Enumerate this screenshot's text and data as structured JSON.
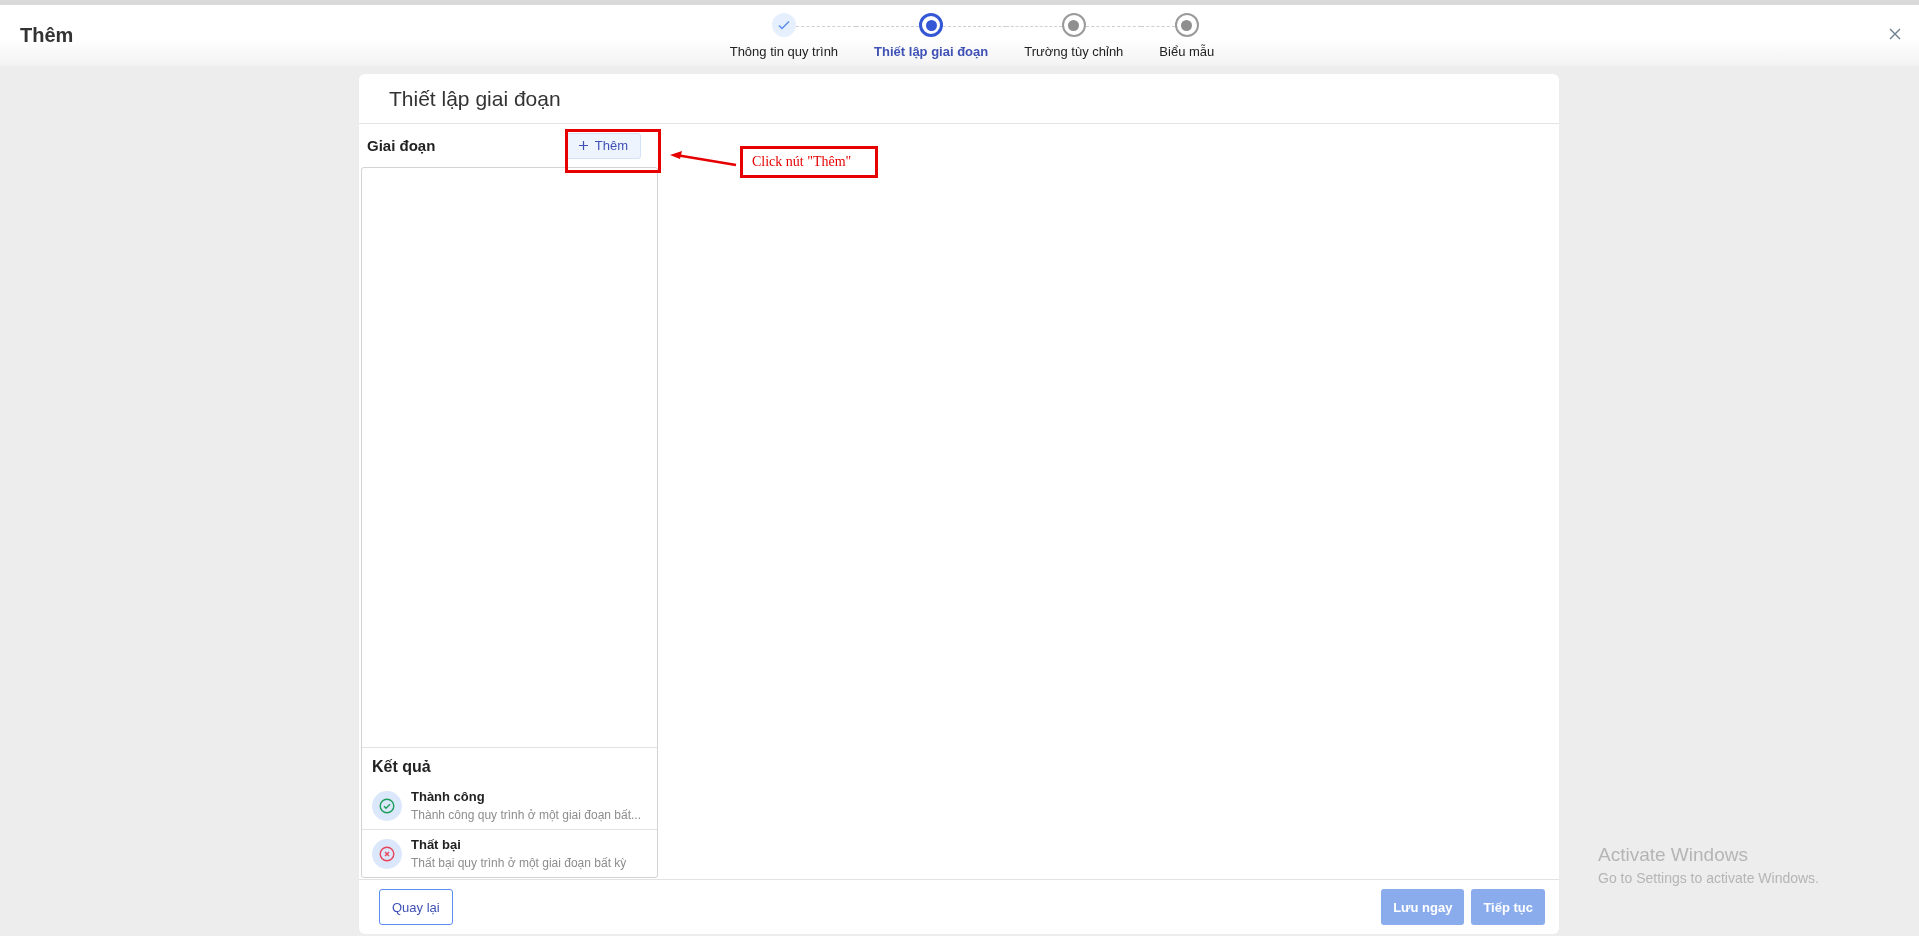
{
  "header": {
    "title": "Thêm"
  },
  "steps": [
    {
      "label": "Thông tin quy trình",
      "kind": "done"
    },
    {
      "label": "Thiết lập giai đoạn",
      "kind": "active"
    },
    {
      "label": "Trường tùy chỉnh",
      "kind": "pending"
    },
    {
      "label": "Biểu mẫu",
      "kind": "pending"
    }
  ],
  "card": {
    "title": "Thiết lập giai đoạn",
    "stages": {
      "heading": "Giai đoạn",
      "add_button": "Thêm"
    },
    "results": {
      "heading": "Kết quả",
      "items": [
        {
          "kind": "success",
          "title": "Thành công",
          "description": "Thành công quy trình ở một giai đoạn bất..."
        },
        {
          "kind": "failure",
          "title": "Thất bại",
          "description": "Thất bại quy trình ở một giai đoạn bất kỳ"
        }
      ]
    },
    "footer_buttons": [
      {
        "label": "Quay lại",
        "kind": "outline",
        "disabled": false
      },
      {
        "label": "Lưu ngay",
        "kind": "primary",
        "disabled": true
      },
      {
        "label": "Tiếp tục",
        "kind": "primary",
        "disabled": true
      }
    ]
  },
  "annotation": {
    "callout": "Click nút \"Thêm\""
  },
  "os_notice": {
    "title": "Activate Windows",
    "subtitle": "Go to Settings to activate Windows."
  }
}
